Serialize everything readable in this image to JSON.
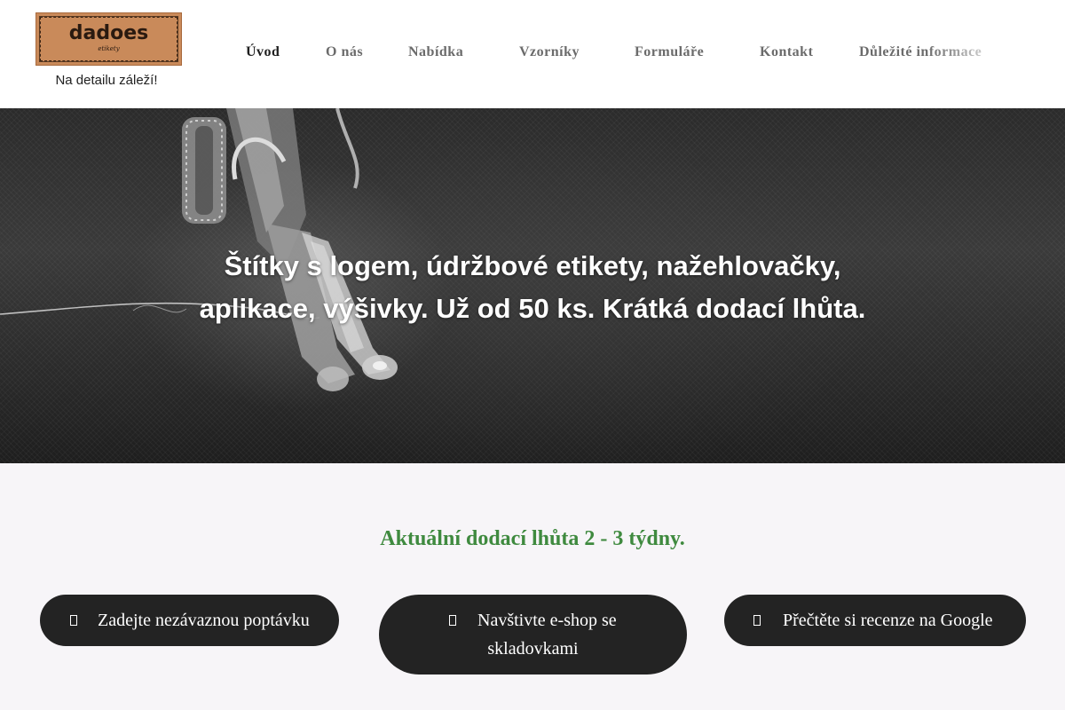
{
  "header": {
    "logo_text": "dadoes",
    "logo_subtext": "etikety",
    "tagline": "Na detailu záleží!"
  },
  "nav": {
    "items": [
      {
        "label": "Úvod"
      },
      {
        "label": "O nás"
      },
      {
        "label": "Nabídka"
      },
      {
        "label": "Vzorníky"
      },
      {
        "label": "Formuláře"
      },
      {
        "label": "Kontakt"
      },
      {
        "label": "Důležité informace"
      }
    ]
  },
  "hero": {
    "line1": "Štítky s logem, údržbové etikety, nažehlovačky,",
    "line2": "aplikace, výšivky. Už od 50 ks. Krátká dodací lhůta."
  },
  "main": {
    "delivery_notice": "Aktuální dodací lhůta 2 - 3 týdny.",
    "buttons": [
      {
        "label": "Zadejte nezávaznou poptávku",
        "icon": "inquiry-icon"
      },
      {
        "label_line1": "Navštivte e-shop se",
        "label_line2": "skladovkami",
        "icon": "shop-icon"
      },
      {
        "label": "Přečtěte si recenze na Google",
        "icon": "review-icon"
      }
    ]
  },
  "colors": {
    "accent_green": "#3f8a3f",
    "button_bg": "#232323",
    "logo_leather": "#c98a5a"
  }
}
